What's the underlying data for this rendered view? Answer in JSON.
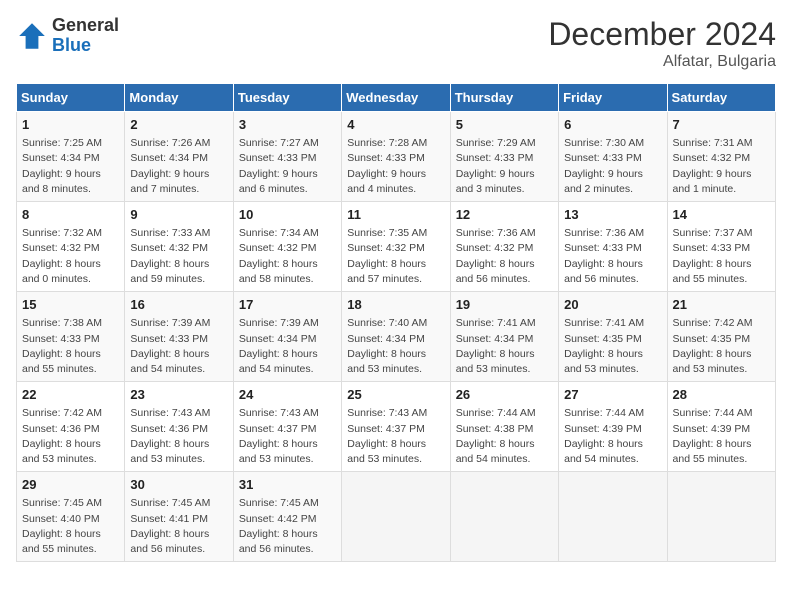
{
  "header": {
    "logo_line1": "General",
    "logo_line2": "Blue",
    "month": "December 2024",
    "location": "Alfatar, Bulgaria"
  },
  "days_of_week": [
    "Sunday",
    "Monday",
    "Tuesday",
    "Wednesday",
    "Thursday",
    "Friday",
    "Saturday"
  ],
  "weeks": [
    [
      {
        "day": "1",
        "sunrise": "7:25 AM",
        "sunset": "4:34 PM",
        "daylight": "9 hours and 8 minutes."
      },
      {
        "day": "2",
        "sunrise": "7:26 AM",
        "sunset": "4:34 PM",
        "daylight": "9 hours and 7 minutes."
      },
      {
        "day": "3",
        "sunrise": "7:27 AM",
        "sunset": "4:33 PM",
        "daylight": "9 hours and 6 minutes."
      },
      {
        "day": "4",
        "sunrise": "7:28 AM",
        "sunset": "4:33 PM",
        "daylight": "9 hours and 4 minutes."
      },
      {
        "day": "5",
        "sunrise": "7:29 AM",
        "sunset": "4:33 PM",
        "daylight": "9 hours and 3 minutes."
      },
      {
        "day": "6",
        "sunrise": "7:30 AM",
        "sunset": "4:33 PM",
        "daylight": "9 hours and 2 minutes."
      },
      {
        "day": "7",
        "sunrise": "7:31 AM",
        "sunset": "4:32 PM",
        "daylight": "9 hours and 1 minute."
      }
    ],
    [
      {
        "day": "8",
        "sunrise": "7:32 AM",
        "sunset": "4:32 PM",
        "daylight": "8 hours and 0 minutes."
      },
      {
        "day": "9",
        "sunrise": "7:33 AM",
        "sunset": "4:32 PM",
        "daylight": "8 hours and 59 minutes."
      },
      {
        "day": "10",
        "sunrise": "7:34 AM",
        "sunset": "4:32 PM",
        "daylight": "8 hours and 58 minutes."
      },
      {
        "day": "11",
        "sunrise": "7:35 AM",
        "sunset": "4:32 PM",
        "daylight": "8 hours and 57 minutes."
      },
      {
        "day": "12",
        "sunrise": "7:36 AM",
        "sunset": "4:32 PM",
        "daylight": "8 hours and 56 minutes."
      },
      {
        "day": "13",
        "sunrise": "7:36 AM",
        "sunset": "4:33 PM",
        "daylight": "8 hours and 56 minutes."
      },
      {
        "day": "14",
        "sunrise": "7:37 AM",
        "sunset": "4:33 PM",
        "daylight": "8 hours and 55 minutes."
      }
    ],
    [
      {
        "day": "15",
        "sunrise": "7:38 AM",
        "sunset": "4:33 PM",
        "daylight": "8 hours and 55 minutes."
      },
      {
        "day": "16",
        "sunrise": "7:39 AM",
        "sunset": "4:33 PM",
        "daylight": "8 hours and 54 minutes."
      },
      {
        "day": "17",
        "sunrise": "7:39 AM",
        "sunset": "4:34 PM",
        "daylight": "8 hours and 54 minutes."
      },
      {
        "day": "18",
        "sunrise": "7:40 AM",
        "sunset": "4:34 PM",
        "daylight": "8 hours and 53 minutes."
      },
      {
        "day": "19",
        "sunrise": "7:41 AM",
        "sunset": "4:34 PM",
        "daylight": "8 hours and 53 minutes."
      },
      {
        "day": "20",
        "sunrise": "7:41 AM",
        "sunset": "4:35 PM",
        "daylight": "8 hours and 53 minutes."
      },
      {
        "day": "21",
        "sunrise": "7:42 AM",
        "sunset": "4:35 PM",
        "daylight": "8 hours and 53 minutes."
      }
    ],
    [
      {
        "day": "22",
        "sunrise": "7:42 AM",
        "sunset": "4:36 PM",
        "daylight": "8 hours and 53 minutes."
      },
      {
        "day": "23",
        "sunrise": "7:43 AM",
        "sunset": "4:36 PM",
        "daylight": "8 hours and 53 minutes."
      },
      {
        "day": "24",
        "sunrise": "7:43 AM",
        "sunset": "4:37 PM",
        "daylight": "8 hours and 53 minutes."
      },
      {
        "day": "25",
        "sunrise": "7:43 AM",
        "sunset": "4:37 PM",
        "daylight": "8 hours and 53 minutes."
      },
      {
        "day": "26",
        "sunrise": "7:44 AM",
        "sunset": "4:38 PM",
        "daylight": "8 hours and 54 minutes."
      },
      {
        "day": "27",
        "sunrise": "7:44 AM",
        "sunset": "4:39 PM",
        "daylight": "8 hours and 54 minutes."
      },
      {
        "day": "28",
        "sunrise": "7:44 AM",
        "sunset": "4:39 PM",
        "daylight": "8 hours and 55 minutes."
      }
    ],
    [
      {
        "day": "29",
        "sunrise": "7:45 AM",
        "sunset": "4:40 PM",
        "daylight": "8 hours and 55 minutes."
      },
      {
        "day": "30",
        "sunrise": "7:45 AM",
        "sunset": "4:41 PM",
        "daylight": "8 hours and 56 minutes."
      },
      {
        "day": "31",
        "sunrise": "7:45 AM",
        "sunset": "4:42 PM",
        "daylight": "8 hours and 56 minutes."
      },
      null,
      null,
      null,
      null
    ]
  ]
}
